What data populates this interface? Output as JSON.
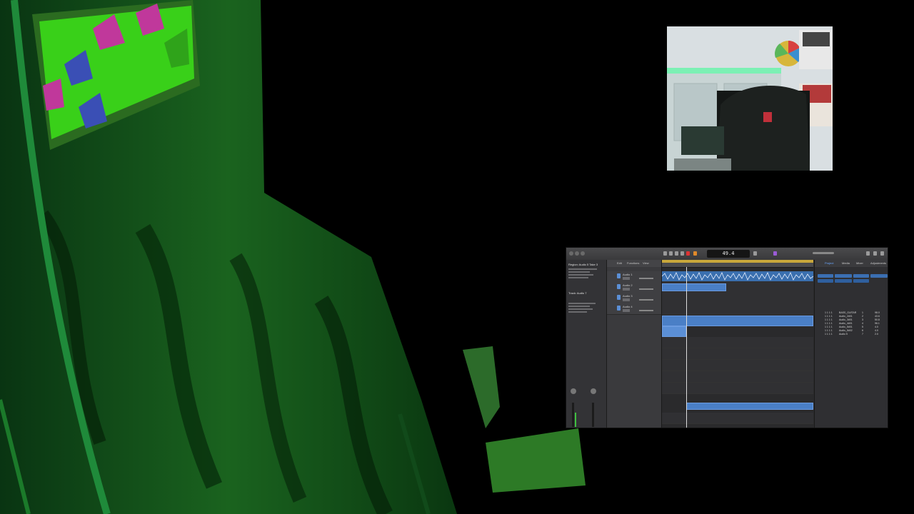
{
  "scene": {
    "description_hidden": true
  },
  "daw": {
    "transport_display": "49.4",
    "menu": [
      "Edit",
      "Functions",
      "View"
    ],
    "inspector": {
      "section_region": "Region: Audio 5 Take 3",
      "section_track": "Track: Audio 7"
    },
    "tracks": [
      {
        "name": "Audio 1"
      },
      {
        "name": "Audio 2"
      },
      {
        "name": "Audio 3"
      },
      {
        "name": "Audio 4"
      }
    ],
    "browser": {
      "tabs": [
        "Project",
        "Media",
        "Mixer",
        "Adjustments"
      ],
      "rows": [
        {
          "pos": "1 1 1 1",
          "name": "BASS_GUITAR",
          "num": "1",
          "val": "98.0"
        },
        {
          "pos": "1 1 1 1",
          "name": "Audio_2#01",
          "num": "2",
          "val": "43.6"
        },
        {
          "pos": "1 1 1 1",
          "name": "Audio_3#01",
          "num": "3",
          "val": "50.8"
        },
        {
          "pos": "1 1 1 1",
          "name": "Audio_4#01",
          "num": "4",
          "val": "96.1"
        },
        {
          "pos": "1 1 1 1",
          "name": "Audio_5#01",
          "num": "5",
          "val": "4.0"
        },
        {
          "pos": "1 1 1 1",
          "name": "Audio_5#02",
          "num": "6",
          "val": "4.0"
        },
        {
          "pos": "1 1 1 1",
          "name": "Audio 5",
          "num": "7",
          "val": "2.0"
        }
      ]
    }
  }
}
